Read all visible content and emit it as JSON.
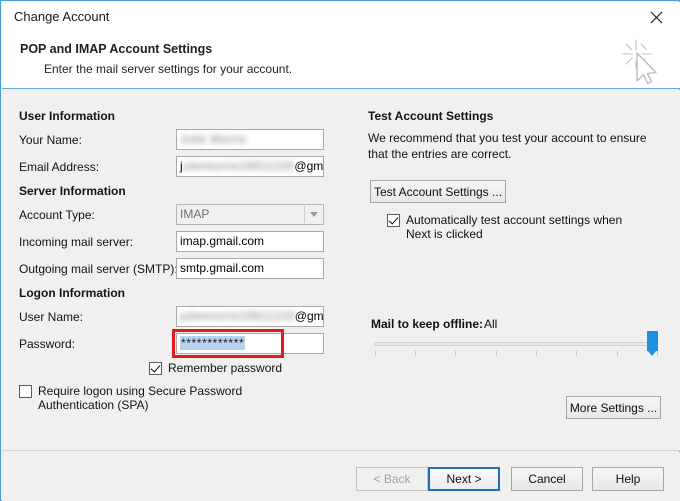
{
  "window": {
    "title": "Change Account",
    "close_icon": "close-icon"
  },
  "header": {
    "title": "POP and IMAP Account Settings",
    "subtitle": "Enter the mail server settings for your account.",
    "icon": "cursor-sparkle-icon"
  },
  "user_information": {
    "section_title": "User Information",
    "your_name": {
      "label": "Your Name:",
      "value_redacted": "Julie Morris",
      "value_visible_tail": ""
    },
    "email_address": {
      "label": "Email Address:",
      "value_prefix": "j",
      "value_redacted": "uliemorris19811220",
      "value_visible_tail": "@gmail."
    }
  },
  "server_information": {
    "section_title": "Server Information",
    "account_type": {
      "label": "Account Type:",
      "value": "IMAP",
      "disabled": true,
      "arrow_icon": "chevron-down-icon"
    },
    "incoming_mail_server": {
      "label": "Incoming mail server:",
      "value": "imap.gmail.com"
    },
    "outgoing_mail_server": {
      "label": "Outgoing mail server (SMTP):",
      "value": "smtp.gmail.com"
    }
  },
  "logon_information": {
    "section_title": "Logon Information",
    "user_name": {
      "label": "User Name:",
      "value_redacted": "juliemorris19811220",
      "value_visible_tail": "@gmail."
    },
    "password": {
      "label": "Password:",
      "value": "************",
      "selected": true,
      "highlight_color": "#e01b1b"
    },
    "remember_password": {
      "label": "Remember password",
      "checked": true
    },
    "require_spa": {
      "label": "Require logon using Secure Password Authentication (SPA)",
      "checked": false
    }
  },
  "test_account": {
    "section_title": "Test Account Settings",
    "description": "We recommend that you test your account to ensure that the entries are correct.",
    "test_button": "Test Account Settings ...",
    "auto_test": {
      "label": "Automatically test account settings when Next is clicked",
      "checked": true
    }
  },
  "offline_slider": {
    "label": "Mail to keep offline:",
    "value": "All",
    "position_percent": 100,
    "tick_count": 8,
    "accent_color": "#1e90e0"
  },
  "more_settings_button": "More Settings ...",
  "footer": {
    "back": "< Back",
    "back_disabled": true,
    "next": "Next >",
    "next_focused": true,
    "cancel": "Cancel",
    "help": "Help"
  }
}
